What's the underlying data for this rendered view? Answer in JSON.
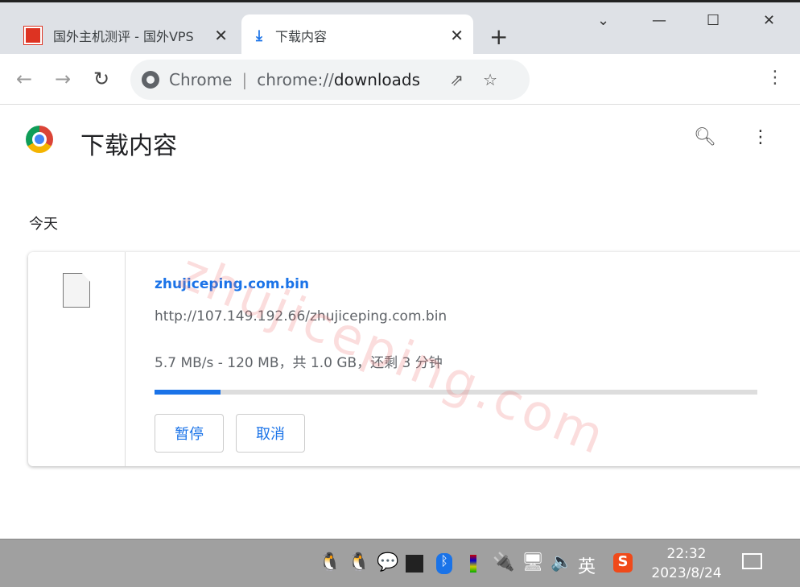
{
  "tabs": [
    {
      "label": "国外主机测评 - 国外VPS",
      "favicon": "site-seal-icon"
    },
    {
      "label": "下载内容",
      "favicon": "download-icon",
      "active": true
    }
  ],
  "omnibox": {
    "origin": "Chrome",
    "url_prefix": "chrome://",
    "url_path": "downloads"
  },
  "page": {
    "title": "下载内容",
    "section": "今天"
  },
  "download": {
    "filename": "zhujiceping.com.bin",
    "url": "http://107.149.192.66/zhujiceping.com.bin",
    "status": "5.7 MB/s - 120 MB，共 1.0 GB，还剩 3 分钟",
    "progress_percent": 11,
    "pause_label": "暂停",
    "cancel_label": "取消"
  },
  "watermark": "zhujiceping.com",
  "taskbar": {
    "ime": "英",
    "time": "22:32",
    "date": "2023/8/24"
  },
  "colors": {
    "accent": "#1a73e8"
  }
}
